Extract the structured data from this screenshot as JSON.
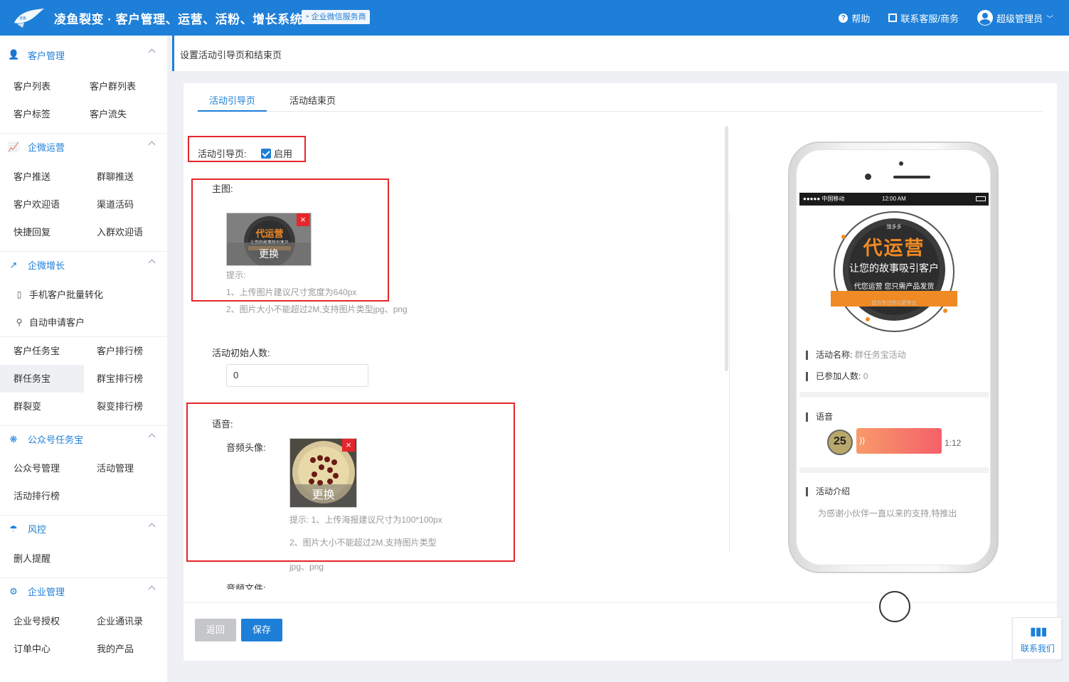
{
  "header": {
    "title": "凌鱼裂变 · 客户管理、运营、活粉、增长系统",
    "badge": "企业微信服务商",
    "help": "帮助",
    "contact": "联系客服/商务",
    "user": "超级管理员"
  },
  "sidebar": {
    "sections": [
      {
        "title": "客户管理",
        "icon": "user-icon",
        "items": [
          "客户列表",
          "客户群列表",
          "客户标签",
          "客户流失"
        ]
      },
      {
        "title": "企微运营",
        "icon": "chart-icon",
        "items": [
          "客户推送",
          "群聊推送",
          "客户欢迎语",
          "渠道活码",
          "快捷回复",
          "入群欢迎语"
        ]
      },
      {
        "title": "企微增长",
        "icon": "trend-icon",
        "items": [
          "手机客户批量转化",
          "自动申请客户",
          "客户任务宝",
          "客户排行榜",
          "群任务宝",
          "群宝排行榜",
          "群裂变",
          "裂变排行榜"
        ]
      },
      {
        "title": "公众号任务宝",
        "icon": "snowflake-icon",
        "items": [
          "公众号管理",
          "活动管理",
          "活动排行榜"
        ]
      },
      {
        "title": "风控",
        "icon": "umbrella-icon",
        "items": [
          "删人提醒"
        ]
      },
      {
        "title": "企业管理",
        "icon": "gear-icon",
        "items": [
          "企业号授权",
          "企业通讯录",
          "订单中心",
          "我的产品"
        ]
      }
    ],
    "active_item": "群任务宝"
  },
  "breadcrumb": "设置活动引导页和结束页",
  "tabs": [
    "活动引导页",
    "活动结束页"
  ],
  "form": {
    "guide_label": "活动引导页:",
    "guide_enable": "启用",
    "main_image_label": "主图:",
    "replace": "更换",
    "close": "×",
    "hint_title": "提示:",
    "main_hint_1": "1、上传图片建议尺寸宽度为640px",
    "main_hint_2": "2、图片大小不能超过2M,支持图片类型jpg、png",
    "initial_count_label": "活动初始人数:",
    "initial_count_value": "0",
    "voice_label": "语音:",
    "audio_avatar_label": "音频头像:",
    "audio_hint_1": "提示: 1、上传海报建议尺寸为100*100px",
    "audio_hint_2": "2、图片大小不能超过2M,支持图片类型",
    "audio_hint_3": "jpg、png",
    "audio_file_label": "音频文件:"
  },
  "buttons": {
    "back": "返回",
    "save": "保存"
  },
  "phone": {
    "carrier": "●●●●● 中国移动",
    "time": "12:00 AM",
    "poster": {
      "brand": "饿多多",
      "title": "代运营",
      "subtitle": "让您的故事吸引客户",
      "ribbon": "代您运营 您只需产品发货",
      "footer": "因为专注所以更专业"
    },
    "activity_name_label": "活动名称:",
    "activity_name_value": "群任务宝活动",
    "joined_label": "已参加人数:",
    "joined_value": "0",
    "voice_title": "语音",
    "voice_duration": "1:12",
    "intro_title": "活动介绍",
    "intro_text": "为感谢小伙伴一直以来的支持,特推出"
  },
  "float_contact": "联系我们",
  "colors": {
    "primary": "#1e7fd8",
    "danger": "#e6262c",
    "accent": "#f08a24"
  }
}
